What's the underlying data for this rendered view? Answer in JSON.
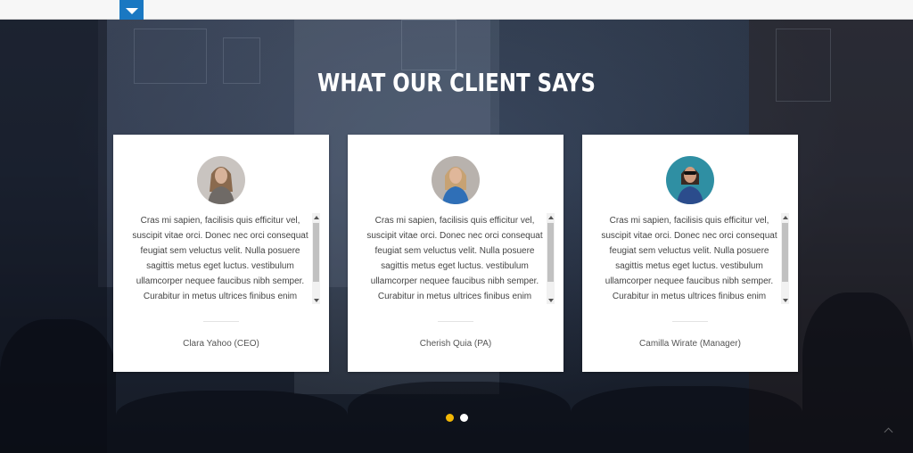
{
  "section": {
    "title": "WHAT OUR CLIENT SAYS"
  },
  "testimonials": [
    {
      "quote": "Cras mi sapien, facilisis quis efficitur vel, suscipit vitae orci. Donec nec orci consequat feugiat sem veluctus velit. Nulla posuere sagittis metus eget luctus. vestibulum ullamcorper nequee faucibus nibh semper. Curabitur in metus ultrices finibus enim",
      "name": "Clara Yahoo (CEO)",
      "avatar": {
        "bg": "#c9c4c0",
        "hair": "#8a6a4e",
        "skin": "#d8b39a",
        "top": "#6f6a66"
      }
    },
    {
      "quote": "Cras mi sapien, facilisis quis efficitur vel, suscipit vitae orci. Donec nec orci consequat feugiat sem veluctus velit. Nulla posuere sagittis metus eget luctus. vestibulum ullamcorper nequee faucibus nibh semper. Curabitur in metus ultrices finibus enim",
      "name": "Cherish Quia (PA)",
      "avatar": {
        "bg": "#b8b2ad",
        "hair": "#c7a273",
        "skin": "#e0b79a",
        "top": "#2f6fb7"
      }
    },
    {
      "quote": "Cras mi sapien, facilisis quis efficitur vel, suscipit vitae orci. Donec nec orci consequat feugiat sem veluctus velit. Nulla posuere sagittis metus eget luctus. vestibulum ullamcorper nequee faucibus nibh semper. Curabitur in metus ultrices finibus enim",
      "name": "Camilla Wirate (Manager)",
      "avatar": {
        "bg": "#2f8fa3",
        "hair": "#3a2a22",
        "skin": "#d09c7e",
        "top": "#2b4c8c"
      }
    }
  ],
  "carousel": {
    "active_color": "#f2b705",
    "inactive_color": "#ffffff",
    "slides": 2,
    "active_index": 0
  },
  "icons": {
    "topbar_toggle": "chevron-down-icon",
    "back_to_top": "chevron-up-icon"
  },
  "colors": {
    "topbar_accent": "#1a78c2"
  }
}
